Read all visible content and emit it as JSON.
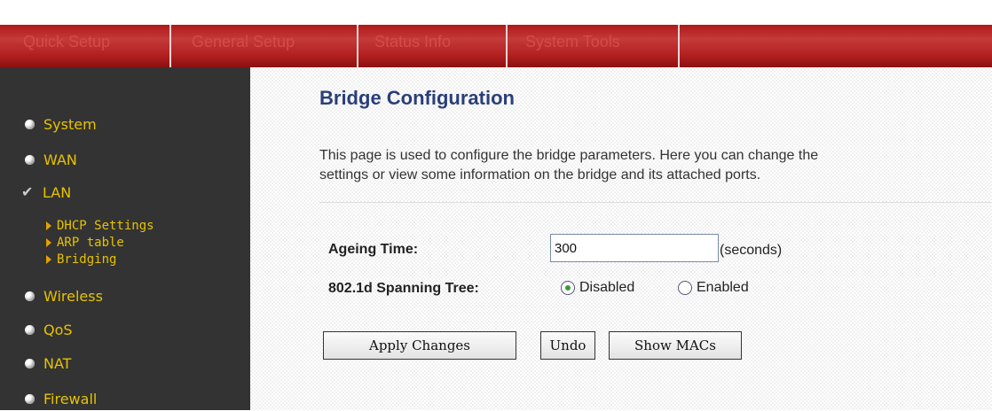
{
  "nav": {
    "tabs": [
      "Quick Setup",
      "General Setup",
      "Status Info",
      "System Tools"
    ]
  },
  "sidebar": {
    "items": [
      {
        "label": "System",
        "icon": "bullet-icon"
      },
      {
        "label": "WAN",
        "icon": "bullet-icon"
      },
      {
        "label": "LAN",
        "icon": "check-icon"
      },
      {
        "label": "Wireless",
        "icon": "bullet-icon"
      },
      {
        "label": "QoS",
        "icon": "bullet-icon"
      },
      {
        "label": "NAT",
        "icon": "bullet-icon"
      },
      {
        "label": "Firewall",
        "icon": "bullet-icon"
      }
    ],
    "subitems": [
      {
        "label": "DHCP Settings",
        "icon": "triangle-icon"
      },
      {
        "label": "ARP table",
        "icon": "triangle-icon"
      },
      {
        "label": "Bridging",
        "icon": "triangle-icon"
      }
    ]
  },
  "main": {
    "title": "Bridge Configuration",
    "description_line1": "This page is used to configure the bridge parameters. Here you can change the",
    "description_line2": "settings or view some information on the bridge and its attached ports.",
    "ageing_label": "Ageing Time:",
    "ageing_value": "300",
    "ageing_unit": "(seconds)",
    "stp_label": "802.1d Spanning Tree:",
    "stp_options": [
      {
        "label": "Disabled",
        "selected": true
      },
      {
        "label": "Enabled",
        "selected": false
      }
    ],
    "buttons": {
      "apply": "Apply Changes",
      "undo": "Undo",
      "show_macs": "Show MACs"
    }
  },
  "colors": {
    "nav_red": "#b01818",
    "sidebar_bg": "#333333",
    "sidebar_text": "#e6c200",
    "title_blue": "#2a3f7a"
  }
}
